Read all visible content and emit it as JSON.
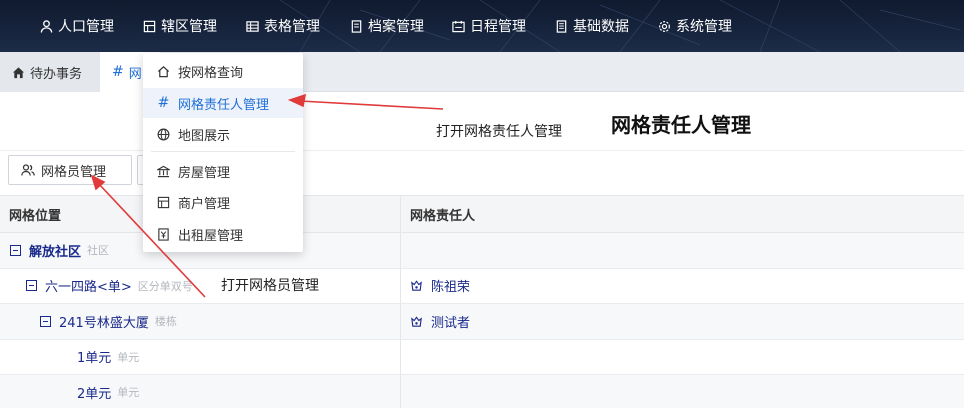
{
  "nav": {
    "items": [
      {
        "label": "人口管理",
        "icon": "person-icon"
      },
      {
        "label": "辖区管理",
        "icon": "building-icon"
      },
      {
        "label": "表格管理",
        "icon": "table-icon"
      },
      {
        "label": "档案管理",
        "icon": "file-icon"
      },
      {
        "label": "日程管理",
        "icon": "calendar-icon"
      },
      {
        "label": "基础数据",
        "icon": "document-icon"
      },
      {
        "label": "系统管理",
        "icon": "gear-icon"
      }
    ]
  },
  "tabs": {
    "home_label": "待办事务",
    "active_label": "网"
  },
  "page": {
    "title": "网格责任人管理"
  },
  "annotations": {
    "open_responsible": "打开网格责任人管理",
    "open_grid_staff": "打开网格员管理"
  },
  "toolbar": {
    "grid_staff_label": "网格员管理"
  },
  "menu": {
    "items": [
      {
        "label": "按网格查询",
        "icon": "home-icon"
      },
      {
        "label": "网格责任人管理",
        "icon": "hash-icon"
      },
      {
        "label": "地图展示",
        "icon": "globe-icon"
      },
      {
        "label": "房屋管理",
        "icon": "bank-icon"
      },
      {
        "label": "商户管理",
        "icon": "shop-icon"
      },
      {
        "label": "出租屋管理",
        "icon": "rental-icon"
      }
    ]
  },
  "table": {
    "headers": [
      "网格位置",
      "网格责任人"
    ],
    "rows": [
      {
        "name": "解放社区",
        "type": "社区",
        "person": ""
      },
      {
        "name": "六一四路<单>",
        "type": "区分单双号",
        "person": "陈祖荣"
      },
      {
        "name": "241号林盛大厦",
        "type": "楼栋",
        "person": "测试者"
      },
      {
        "name": "1单元",
        "type": "单元",
        "person": ""
      },
      {
        "name": "2单元",
        "type": "单元",
        "person": ""
      }
    ]
  },
  "colors": {
    "nav_bg": "#17243d",
    "accent": "#1f6fd6",
    "tree_text": "#1a2a8a",
    "arrow": "#e03a3a"
  }
}
